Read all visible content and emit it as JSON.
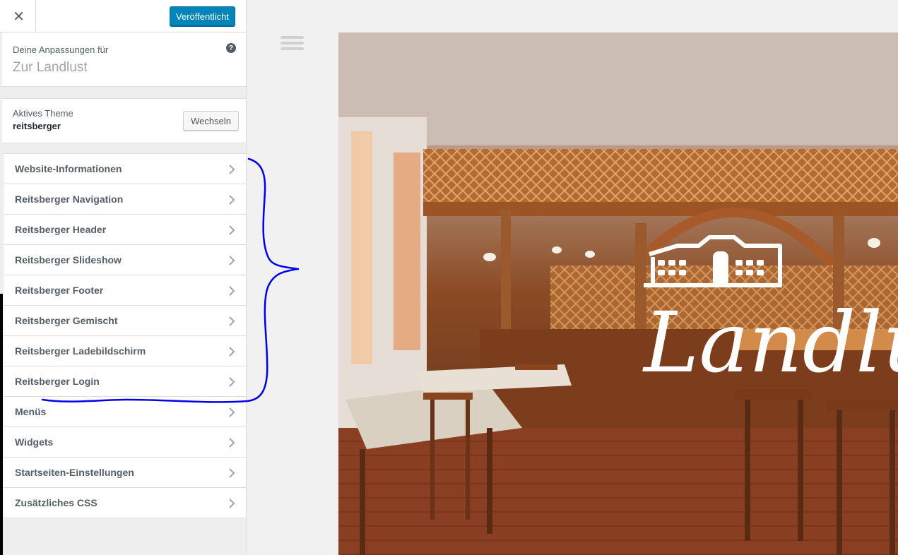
{
  "topbar": {
    "close_icon": "close-icon",
    "publish_label": "Veröffentlicht"
  },
  "info": {
    "prefix": "Deine Anpassungen für",
    "site_title": "Zur Landlust",
    "help_icon": "help-icon",
    "help_glyph": "?"
  },
  "theme": {
    "label": "Aktives Theme",
    "name": "reitsberger",
    "switch_label": "Wechseln"
  },
  "menu": [
    {
      "label": "Website-Informationen"
    },
    {
      "label": "Reitsberger Navigation"
    },
    {
      "label": "Reitsberger Header"
    },
    {
      "label": "Reitsberger Slideshow"
    },
    {
      "label": "Reitsberger Footer"
    },
    {
      "label": "Reitsberger Gemischt"
    },
    {
      "label": "Reitsberger Ladebildschirm"
    },
    {
      "label": "Reitsberger Login"
    },
    {
      "label": "Menüs"
    },
    {
      "label": "Widgets"
    },
    {
      "label": "Startseiten-Einstellungen"
    },
    {
      "label": "Zusätzliches CSS"
    }
  ],
  "preview": {
    "logo_text": "Landlust",
    "annotation_color": "#0000ee"
  },
  "colors": {
    "primary": "#0085ba",
    "panel_bg": "#eeeeee",
    "text": "#555d66"
  }
}
